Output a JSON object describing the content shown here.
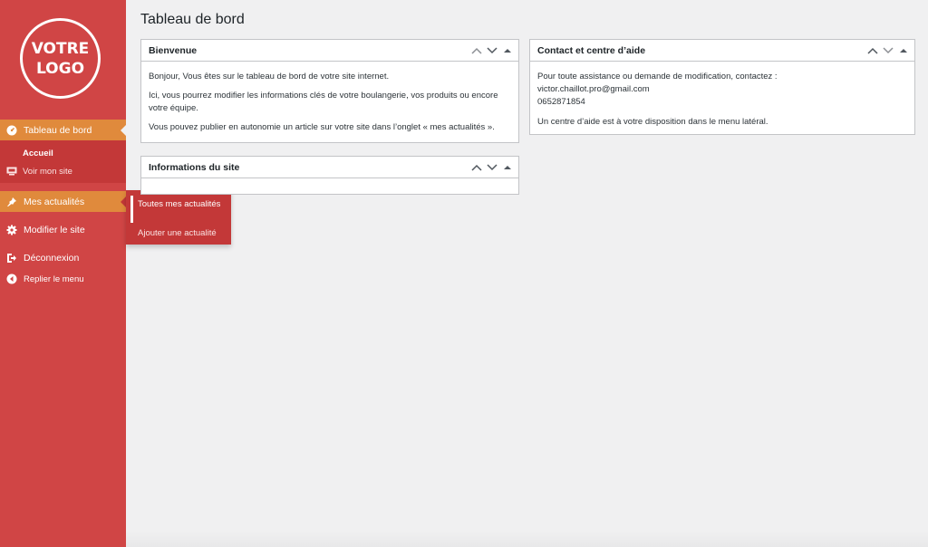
{
  "sidebar": {
    "logo_line1": "VOTRE",
    "logo_line2": "LOGO",
    "items": {
      "dashboard": {
        "label": "Tableau de bord",
        "icon": "dashboard-icon"
      },
      "accueil": {
        "label": "Accueil"
      },
      "voir_site": {
        "label": "Voir mon site",
        "icon": "monitor-icon"
      },
      "actualites": {
        "label": "Mes actualités",
        "icon": "pin-icon"
      },
      "modifier": {
        "label": "Modifier le site",
        "icon": "gear-icon"
      },
      "deconnexion": {
        "label": "Déconnexion",
        "icon": "logout-icon"
      },
      "replier": {
        "label": "Replier le menu",
        "icon": "collapse-icon"
      }
    }
  },
  "flyout": {
    "item1": "Toutes mes actualités",
    "item2": "Ajouter une actualité"
  },
  "main": {
    "title": "Tableau de bord",
    "bienvenue": {
      "title": "Bienvenue",
      "p1": "Bonjour, Vous êtes sur le tableau de bord de votre site internet.",
      "p2": "Ici, vous pourrez modifier les informations clés de votre boulangerie, vos produits ou encore votre équipe.",
      "p3": "Vous pouvez publier en autonomie un article sur votre site dans l’onglet « mes actualités »."
    },
    "contact": {
      "title": "Contact et centre d’aide",
      "line1": "Pour toute assistance ou demande de modification, contactez :",
      "email": "victor.chaillot.pro@gmail.com",
      "phone": "0652871854",
      "line2": "Un centre d’aide est à votre disposition dans le menu latéral."
    },
    "infos": {
      "title": "Informations du site"
    }
  },
  "colors": {
    "sidebar": "#d04545",
    "active": "#e08a3c",
    "submenu": "#c33838",
    "background": "#f0f0f1"
  }
}
